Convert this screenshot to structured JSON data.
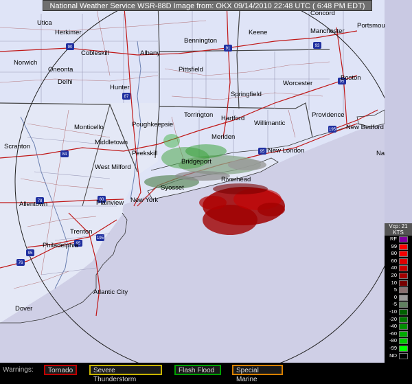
{
  "header": {
    "title": "National Weather Service WSR-88D Image from: OKX 09/14/2010 22:48 UTC ( 6:48 PM EDT)"
  },
  "map": {
    "cities": [
      {
        "name": "Concord"
      },
      {
        "name": "Utica"
      },
      {
        "name": "Herkimer"
      },
      {
        "name": "Keene"
      },
      {
        "name": "Manchester"
      },
      {
        "name": "Portsmouth"
      },
      {
        "name": "Bennington"
      },
      {
        "name": "Cobleskill"
      },
      {
        "name": "Albany"
      },
      {
        "name": "Norwich"
      },
      {
        "name": "Oneonta"
      },
      {
        "name": "Pittsfield"
      },
      {
        "name": "Boston"
      },
      {
        "name": "Delhi"
      },
      {
        "name": "Hunter"
      },
      {
        "name": "Springfield"
      },
      {
        "name": "Worcester"
      },
      {
        "name": "Torrington"
      },
      {
        "name": "Hartford"
      },
      {
        "name": "Providence"
      },
      {
        "name": "Monticello"
      },
      {
        "name": "Poughkeepsie"
      },
      {
        "name": "Willimantic"
      },
      {
        "name": "New Bedford"
      },
      {
        "name": "Scranton"
      },
      {
        "name": "Middletown"
      },
      {
        "name": "Meriden"
      },
      {
        "name": "New London"
      },
      {
        "name": "Nantucket"
      },
      {
        "name": "Peekskill"
      },
      {
        "name": "Bridgeport"
      },
      {
        "name": "West Milford"
      },
      {
        "name": "Riverhead"
      },
      {
        "name": "Syosset"
      },
      {
        "name": "Allentown"
      },
      {
        "name": "Plainview"
      },
      {
        "name": "New York"
      },
      {
        "name": "Trenton"
      },
      {
        "name": "Philadelphia"
      },
      {
        "name": "Atlantic City"
      },
      {
        "name": "Dover"
      }
    ],
    "highways": [
      "90",
      "93",
      "91",
      "87",
      "95",
      "84",
      "95",
      "195",
      "80",
      "95",
      "78",
      "76",
      "195",
      "95"
    ]
  },
  "legend": {
    "title_top": "Vcp: 21",
    "title_units": "KTS",
    "rows": [
      {
        "label": "RF",
        "color": "#7f00a0"
      },
      {
        "label": "99",
        "color": "#ff0000"
      },
      {
        "label": "80",
        "color": "#f20000"
      },
      {
        "label": "60",
        "color": "#e00000"
      },
      {
        "label": "40",
        "color": "#c80000"
      },
      {
        "label": "20",
        "color": "#a20000"
      },
      {
        "label": "10",
        "color": "#780000"
      },
      {
        "label": "5",
        "color": "#8a7070"
      },
      {
        "label": "0",
        "color": "#9a9a9a"
      },
      {
        "label": "-5",
        "color": "#608060"
      },
      {
        "label": "-10",
        "color": "#006000"
      },
      {
        "label": "-20",
        "color": "#007800"
      },
      {
        "label": "-40",
        "color": "#009000"
      },
      {
        "label": "-60",
        "color": "#00aa00"
      },
      {
        "label": "-80",
        "color": "#00c800"
      },
      {
        "label": "-99",
        "color": "#00ff00"
      },
      {
        "label": "ND",
        "color": "#000000"
      }
    ]
  },
  "warnings": {
    "label": "Warnings:",
    "items": [
      {
        "label": "Tornado",
        "color": "#c00000"
      },
      {
        "label": "Severe Thunderstorm",
        "color": "#c8b400"
      },
      {
        "label": "Flash Flood",
        "color": "#00a000"
      },
      {
        "label": "Special Marine",
        "color": "#d88000"
      }
    ]
  }
}
